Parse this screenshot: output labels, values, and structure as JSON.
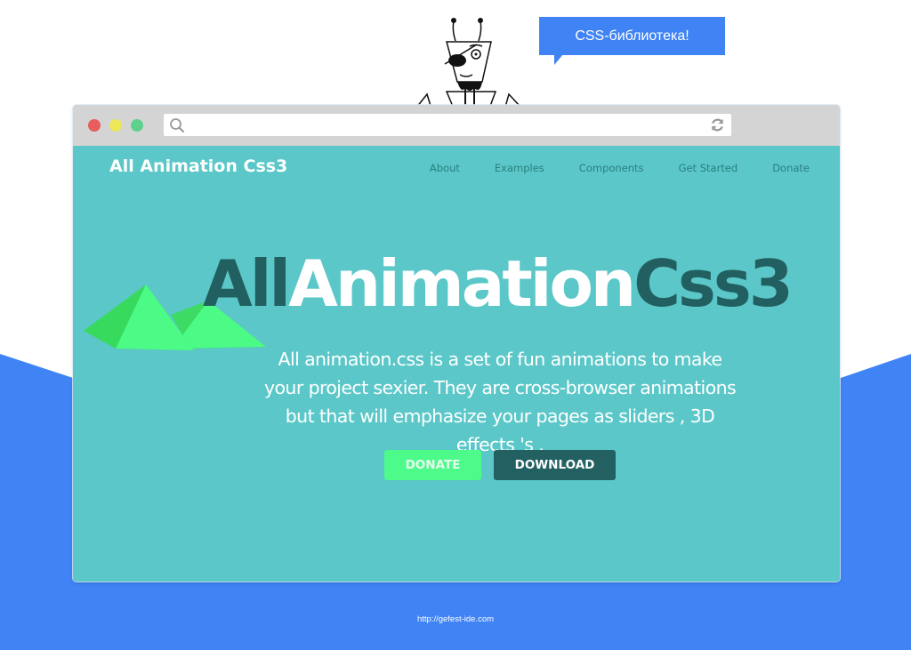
{
  "speech_bubble": {
    "text": "CSS-библиотека!"
  },
  "browser": {
    "url_value": "",
    "icons": {
      "search": "search-icon",
      "reload": "reload-icon"
    },
    "traffic_lights": [
      "close",
      "minimize",
      "maximize"
    ]
  },
  "site": {
    "brand": "All Animation Css3",
    "nav": [
      {
        "label": "About"
      },
      {
        "label": "Examples"
      },
      {
        "label": "Components"
      },
      {
        "label": "Get Started"
      },
      {
        "label": "Donate"
      }
    ],
    "hero": {
      "title_part1": "All",
      "title_part2": "Animation",
      "title_part3": "Css3",
      "description": "All animation.css is a set of fun animations to make your project sexier. They are cross-browser animations but that will emphasize your pages as sliders , 3D effects 's ."
    },
    "buttons": {
      "donate": "DONATE",
      "download": "DOWNLOAD"
    }
  },
  "footer": {
    "link": "http://gefest-ide.com"
  },
  "colors": {
    "page_bg": "#5bc7c8",
    "accent_blue": "#3f83f5",
    "dark_teal": "#225f60",
    "green": "#4dfb8b"
  }
}
